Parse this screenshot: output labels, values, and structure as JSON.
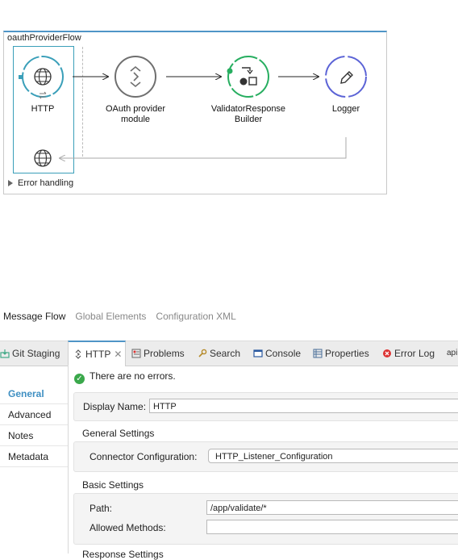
{
  "flow": {
    "name": "oauthProviderFlow",
    "nodes": [
      {
        "label": "HTTP",
        "icon": "globe-icon",
        "color": "#3a9fb9"
      },
      {
        "label": "OAuth provider module",
        "label_lines": [
          "OAuth provider",
          "module"
        ],
        "icon": "oauth-module-icon",
        "color": "#6f6f6f"
      },
      {
        "label": "ValidatorResponse Builder",
        "label_lines": [
          "ValidatorResponse",
          "Builder"
        ],
        "icon": "transform-icon",
        "color": "#27ae60"
      },
      {
        "label": "Logger",
        "icon": "pencil-icon",
        "color": "#5b63d6"
      }
    ],
    "response_icon": "globe-icon",
    "error_handling": "Error handling"
  },
  "editor_tabs": [
    {
      "label": "Message Flow",
      "active": true
    },
    {
      "label": "Global Elements",
      "active": false
    },
    {
      "label": "Configuration XML",
      "active": false
    }
  ],
  "view_tabs": [
    {
      "label": "Git Staging",
      "icon": "git-staging-icon"
    },
    {
      "label": "HTTP",
      "icon": "http-connector-icon",
      "active": true,
      "closable": true
    },
    {
      "label": "Problems",
      "icon": "problems-icon"
    },
    {
      "label": "Search",
      "icon": "search-icon"
    },
    {
      "label": "Console",
      "icon": "console-icon"
    },
    {
      "label": "Properties",
      "icon": "properties-icon"
    },
    {
      "label": "Error Log",
      "icon": "error-log-icon"
    },
    {
      "label": "api"
    }
  ],
  "sidebar": {
    "items": [
      {
        "label": "General",
        "active": true
      },
      {
        "label": "Advanced"
      },
      {
        "label": "Notes"
      },
      {
        "label": "Metadata"
      }
    ]
  },
  "properties": {
    "status": "There are no errors.",
    "display_name_label": "Display Name:",
    "display_name_value": "HTTP",
    "general_settings_title": "General Settings",
    "connector_config_label": "Connector Configuration:",
    "connector_config_value": "HTTP_Listener_Configuration",
    "basic_settings_title": "Basic Settings",
    "path_label": "Path:",
    "path_value": "/app/validate/*",
    "allowed_methods_label": "Allowed Methods:",
    "allowed_methods_value": "",
    "response_settings_title": "Response Settings"
  },
  "colors": {
    "accent": "#4f95c7",
    "selection": "#3a9fb9",
    "success": "#3aa84b"
  }
}
